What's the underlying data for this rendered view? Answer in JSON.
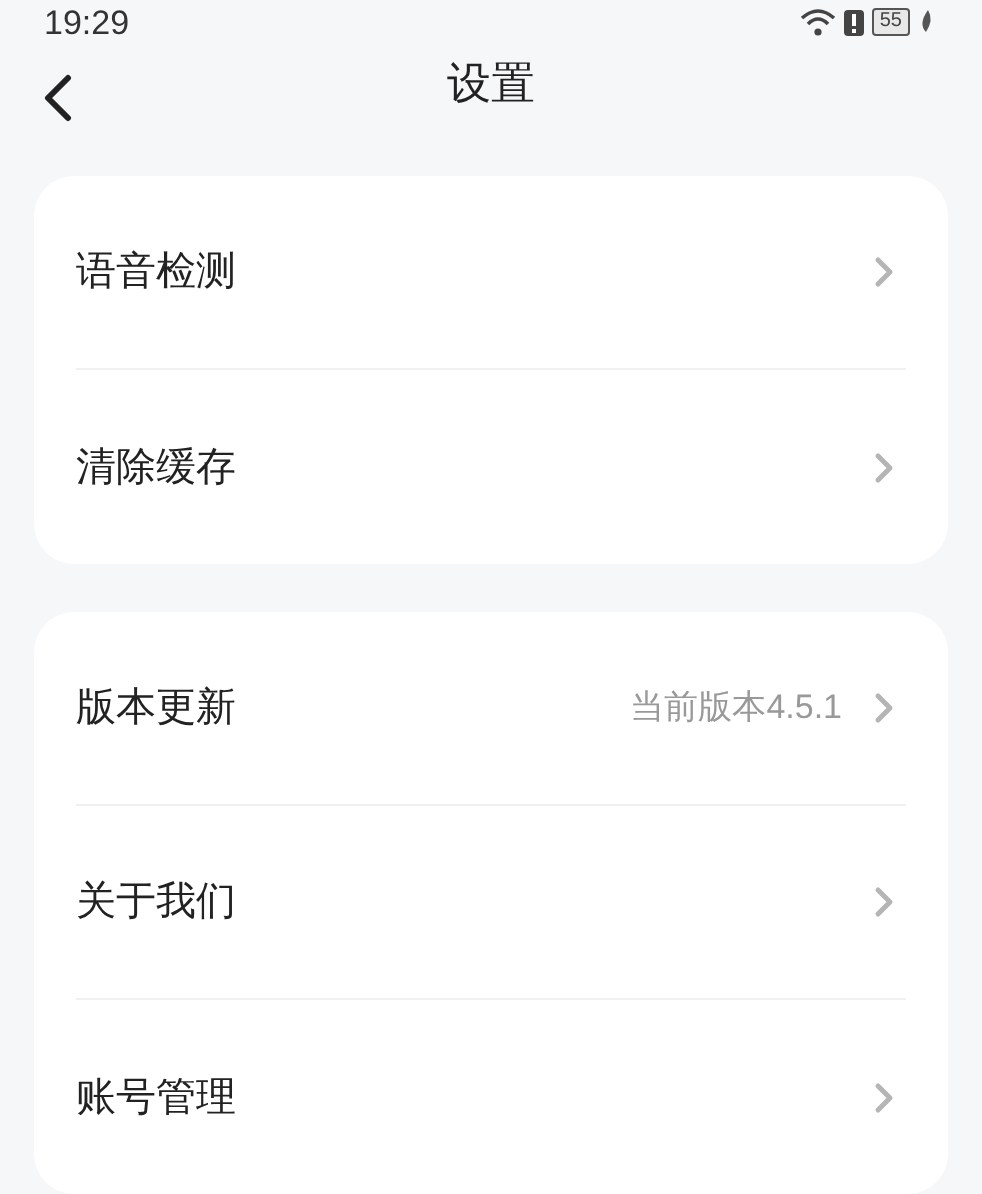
{
  "status_bar": {
    "time": "19:29",
    "battery": "55"
  },
  "header": {
    "title": "设置"
  },
  "groups": [
    {
      "items": [
        {
          "label": "语音检测",
          "chevron": true
        },
        {
          "label": "清除缓存",
          "chevron": true
        }
      ]
    },
    {
      "items": [
        {
          "label": "版本更新",
          "value": "当前版本4.5.1",
          "chevron": true
        },
        {
          "label": "关于我们",
          "chevron": true
        },
        {
          "label": "账号管理",
          "chevron": true
        }
      ]
    }
  ]
}
